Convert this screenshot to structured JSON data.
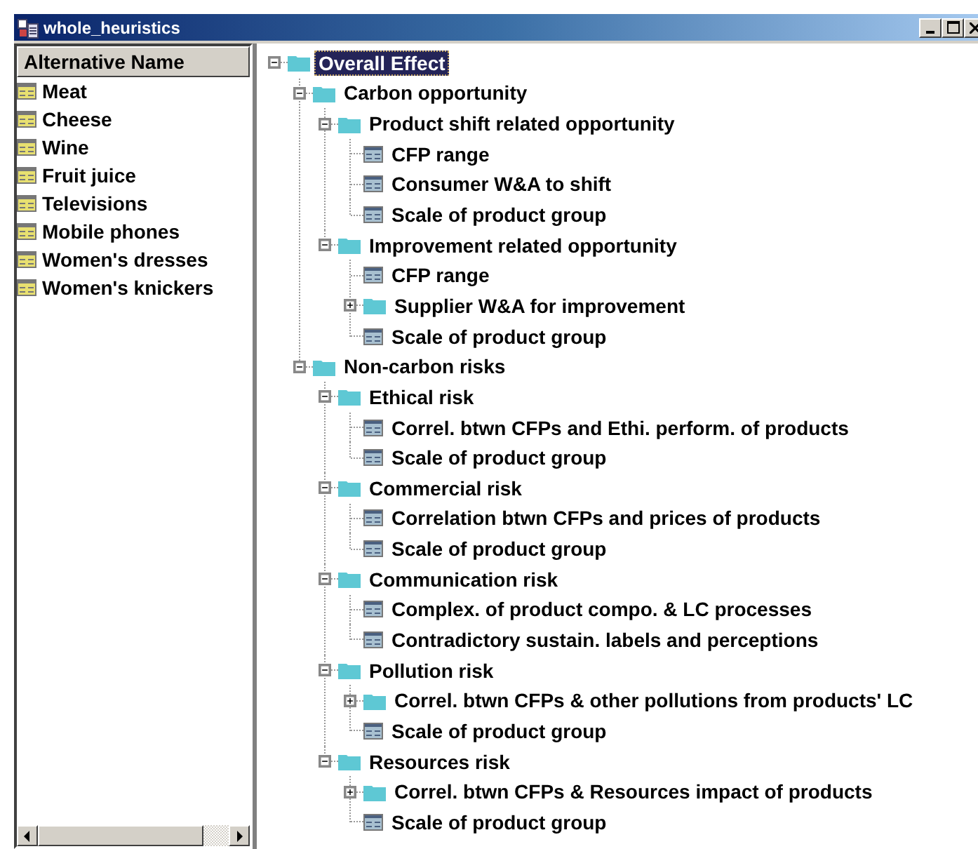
{
  "window": {
    "title": "whole_heuristics"
  },
  "alternatives": {
    "header": "Alternative Name",
    "items": [
      {
        "label": "Meat"
      },
      {
        "label": "Cheese"
      },
      {
        "label": "Wine"
      },
      {
        "label": "Fruit juice"
      },
      {
        "label": "Televisions"
      },
      {
        "label": "Mobile phones"
      },
      {
        "label": "Women's dresses"
      },
      {
        "label": "Women's knickers"
      }
    ]
  },
  "tree": {
    "nodes": [
      {
        "label": "Overall Effect",
        "kind": "folder",
        "expanded": true,
        "selected": true,
        "children": [
          {
            "label": "Carbon opportunity",
            "kind": "folder",
            "expanded": true,
            "selected": false,
            "children": [
              {
                "label": "Product shift related opportunity",
                "kind": "folder",
                "expanded": true,
                "selected": false,
                "children": [
                  {
                    "label": "CFP range",
                    "kind": "leaf",
                    "selected": false
                  },
                  {
                    "label": "Consumer W&A to shift",
                    "kind": "leaf",
                    "selected": false
                  },
                  {
                    "label": "Scale of product group",
                    "kind": "leaf",
                    "selected": false
                  }
                ]
              },
              {
                "label": "Improvement related opportunity",
                "kind": "folder",
                "expanded": true,
                "selected": false,
                "children": [
                  {
                    "label": "CFP range",
                    "kind": "leaf",
                    "selected": false
                  },
                  {
                    "label": "Supplier W&A for improvement",
                    "kind": "folder",
                    "expanded": false,
                    "selected": false
                  },
                  {
                    "label": "Scale of product group",
                    "kind": "leaf",
                    "selected": false
                  }
                ]
              }
            ]
          },
          {
            "label": "Non-carbon risks",
            "kind": "folder",
            "expanded": true,
            "selected": false,
            "children": [
              {
                "label": "Ethical risk",
                "kind": "folder",
                "expanded": true,
                "selected": false,
                "children": [
                  {
                    "label": "Correl. btwn CFPs and Ethi. perform. of products",
                    "kind": "leaf",
                    "selected": false
                  },
                  {
                    "label": "Scale of product group",
                    "kind": "leaf",
                    "selected": false
                  }
                ]
              },
              {
                "label": "Commercial risk",
                "kind": "folder",
                "expanded": true,
                "selected": false,
                "children": [
                  {
                    "label": "Correlation btwn CFPs and prices of products",
                    "kind": "leaf",
                    "selected": false
                  },
                  {
                    "label": "Scale of product group",
                    "kind": "leaf",
                    "selected": false
                  }
                ]
              },
              {
                "label": "Communication risk",
                "kind": "folder",
                "expanded": true,
                "selected": false,
                "children": [
                  {
                    "label": "Complex. of product compo. & LC processes",
                    "kind": "leaf",
                    "selected": false
                  },
                  {
                    "label": "Contradictory sustain. labels and perceptions",
                    "kind": "leaf",
                    "selected": false
                  }
                ]
              },
              {
                "label": "Pollution risk",
                "kind": "folder",
                "expanded": true,
                "selected": false,
                "children": [
                  {
                    "label": "Correl. btwn CFPs & other pollutions from products' LC",
                    "kind": "folder",
                    "expanded": false,
                    "selected": false
                  },
                  {
                    "label": "Scale of product group",
                    "kind": "leaf",
                    "selected": false
                  }
                ]
              },
              {
                "label": "Resources risk",
                "kind": "folder",
                "expanded": true,
                "selected": false,
                "children": [
                  {
                    "label": "Correl. btwn CFPs & Resources impact of products",
                    "kind": "folder",
                    "expanded": false,
                    "selected": false
                  },
                  {
                    "label": "Scale of product group",
                    "kind": "leaf",
                    "selected": false
                  }
                ]
              }
            ]
          }
        ]
      }
    ]
  }
}
